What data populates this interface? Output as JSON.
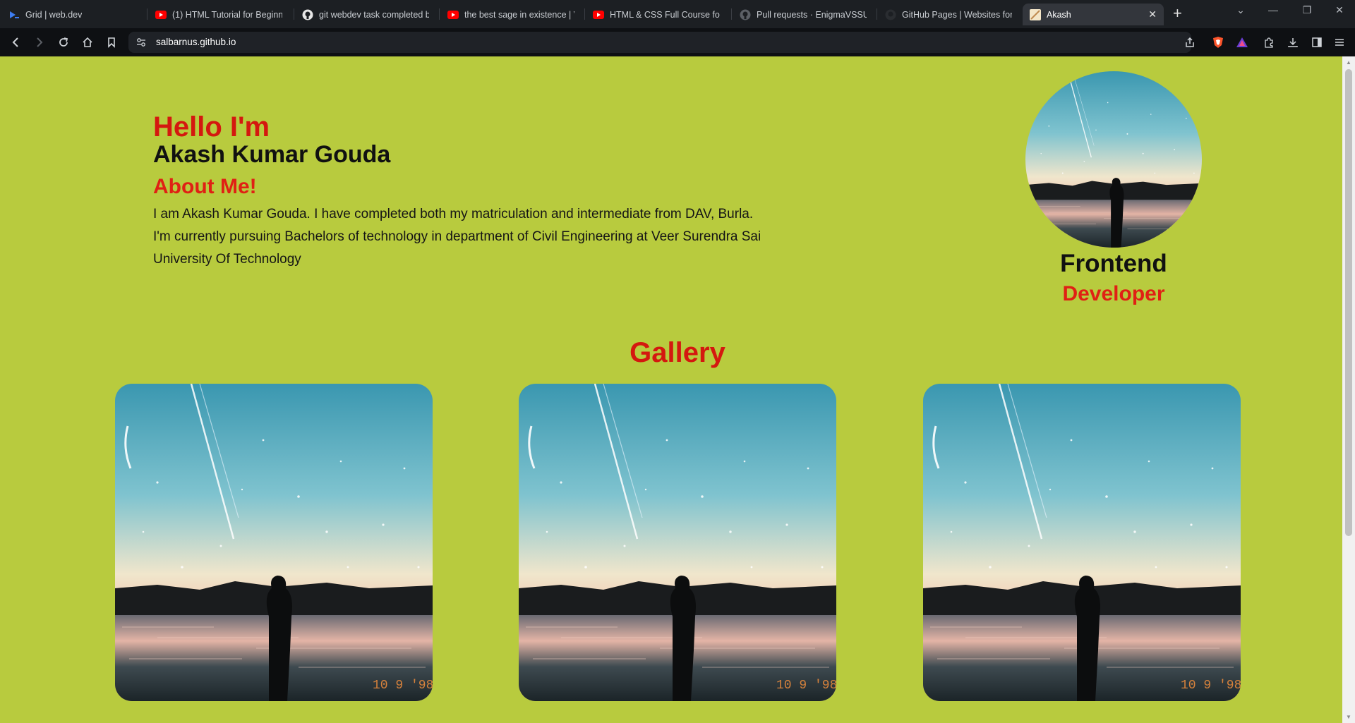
{
  "browser": {
    "tabs": [
      {
        "title": "Grid  |  web.dev",
        "icon": "webdev-icon"
      },
      {
        "title": "(1) HTML Tutorial for Beginners",
        "icon": "youtube-icon"
      },
      {
        "title": "git webdev task completed by",
        "icon": "github-icon"
      },
      {
        "title": "the best sage in existence | VA",
        "icon": "youtube-icon"
      },
      {
        "title": "HTML & CSS Full Course for fr",
        "icon": "youtube-icon"
      },
      {
        "title": "Pull requests · EnigmaVSSUT/",
        "icon": "github-icon"
      },
      {
        "title": "GitHub Pages | Websites for yo",
        "icon": "github-icon"
      },
      {
        "title": "Akash",
        "icon": "page-icon"
      }
    ],
    "url": "salbarnus.github.io"
  },
  "hero": {
    "greeting": "Hello I'm",
    "name": "Akash Kumar Gouda",
    "about_heading": "About Me!",
    "bio": "I am Akash Kumar Gouda. I have completed both my matriculation and intermediate from DAV, Burla. I'm currently pursuing Bachelors of technology in department of Civil Engineering at Veer Surendra Sai University Of Technology"
  },
  "profile": {
    "title_line1": "Frontend",
    "title_line2": "Developer"
  },
  "gallery": {
    "heading": "Gallery",
    "photo_stamp": "10 9 '98"
  },
  "colors": {
    "page_bg": "#b8cb3e",
    "accent_red": "#d4180f",
    "chrome_bg": "#1c1f23"
  }
}
